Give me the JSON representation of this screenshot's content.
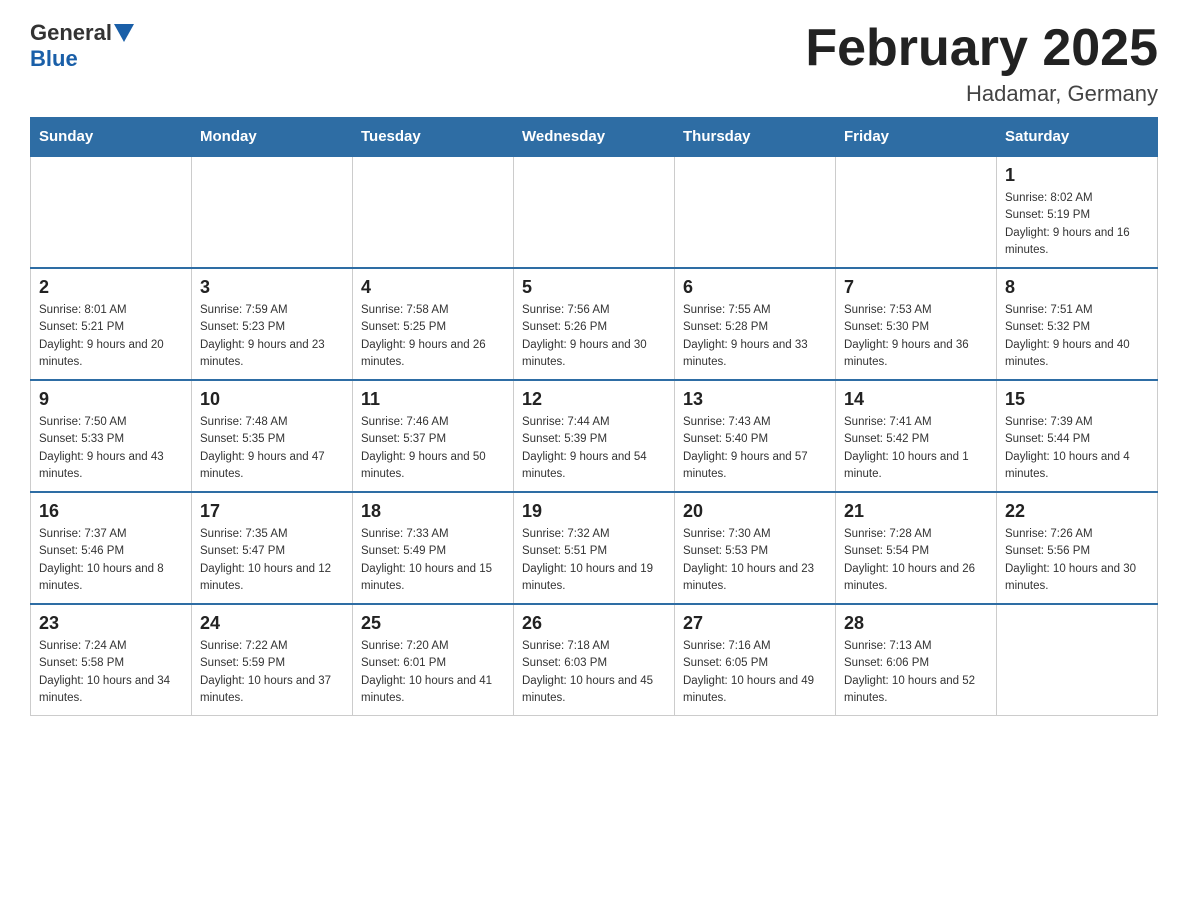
{
  "header": {
    "logo": {
      "general": "General",
      "blue": "Blue"
    },
    "title": "February 2025",
    "location": "Hadamar, Germany"
  },
  "weekdays": [
    "Sunday",
    "Monday",
    "Tuesday",
    "Wednesday",
    "Thursday",
    "Friday",
    "Saturday"
  ],
  "weeks": [
    [
      {
        "day": "",
        "info": ""
      },
      {
        "day": "",
        "info": ""
      },
      {
        "day": "",
        "info": ""
      },
      {
        "day": "",
        "info": ""
      },
      {
        "day": "",
        "info": ""
      },
      {
        "day": "",
        "info": ""
      },
      {
        "day": "1",
        "info": "Sunrise: 8:02 AM\nSunset: 5:19 PM\nDaylight: 9 hours and 16 minutes."
      }
    ],
    [
      {
        "day": "2",
        "info": "Sunrise: 8:01 AM\nSunset: 5:21 PM\nDaylight: 9 hours and 20 minutes."
      },
      {
        "day": "3",
        "info": "Sunrise: 7:59 AM\nSunset: 5:23 PM\nDaylight: 9 hours and 23 minutes."
      },
      {
        "day": "4",
        "info": "Sunrise: 7:58 AM\nSunset: 5:25 PM\nDaylight: 9 hours and 26 minutes."
      },
      {
        "day": "5",
        "info": "Sunrise: 7:56 AM\nSunset: 5:26 PM\nDaylight: 9 hours and 30 minutes."
      },
      {
        "day": "6",
        "info": "Sunrise: 7:55 AM\nSunset: 5:28 PM\nDaylight: 9 hours and 33 minutes."
      },
      {
        "day": "7",
        "info": "Sunrise: 7:53 AM\nSunset: 5:30 PM\nDaylight: 9 hours and 36 minutes."
      },
      {
        "day": "8",
        "info": "Sunrise: 7:51 AM\nSunset: 5:32 PM\nDaylight: 9 hours and 40 minutes."
      }
    ],
    [
      {
        "day": "9",
        "info": "Sunrise: 7:50 AM\nSunset: 5:33 PM\nDaylight: 9 hours and 43 minutes."
      },
      {
        "day": "10",
        "info": "Sunrise: 7:48 AM\nSunset: 5:35 PM\nDaylight: 9 hours and 47 minutes."
      },
      {
        "day": "11",
        "info": "Sunrise: 7:46 AM\nSunset: 5:37 PM\nDaylight: 9 hours and 50 minutes."
      },
      {
        "day": "12",
        "info": "Sunrise: 7:44 AM\nSunset: 5:39 PM\nDaylight: 9 hours and 54 minutes."
      },
      {
        "day": "13",
        "info": "Sunrise: 7:43 AM\nSunset: 5:40 PM\nDaylight: 9 hours and 57 minutes."
      },
      {
        "day": "14",
        "info": "Sunrise: 7:41 AM\nSunset: 5:42 PM\nDaylight: 10 hours and 1 minute."
      },
      {
        "day": "15",
        "info": "Sunrise: 7:39 AM\nSunset: 5:44 PM\nDaylight: 10 hours and 4 minutes."
      }
    ],
    [
      {
        "day": "16",
        "info": "Sunrise: 7:37 AM\nSunset: 5:46 PM\nDaylight: 10 hours and 8 minutes."
      },
      {
        "day": "17",
        "info": "Sunrise: 7:35 AM\nSunset: 5:47 PM\nDaylight: 10 hours and 12 minutes."
      },
      {
        "day": "18",
        "info": "Sunrise: 7:33 AM\nSunset: 5:49 PM\nDaylight: 10 hours and 15 minutes."
      },
      {
        "day": "19",
        "info": "Sunrise: 7:32 AM\nSunset: 5:51 PM\nDaylight: 10 hours and 19 minutes."
      },
      {
        "day": "20",
        "info": "Sunrise: 7:30 AM\nSunset: 5:53 PM\nDaylight: 10 hours and 23 minutes."
      },
      {
        "day": "21",
        "info": "Sunrise: 7:28 AM\nSunset: 5:54 PM\nDaylight: 10 hours and 26 minutes."
      },
      {
        "day": "22",
        "info": "Sunrise: 7:26 AM\nSunset: 5:56 PM\nDaylight: 10 hours and 30 minutes."
      }
    ],
    [
      {
        "day": "23",
        "info": "Sunrise: 7:24 AM\nSunset: 5:58 PM\nDaylight: 10 hours and 34 minutes."
      },
      {
        "day": "24",
        "info": "Sunrise: 7:22 AM\nSunset: 5:59 PM\nDaylight: 10 hours and 37 minutes."
      },
      {
        "day": "25",
        "info": "Sunrise: 7:20 AM\nSunset: 6:01 PM\nDaylight: 10 hours and 41 minutes."
      },
      {
        "day": "26",
        "info": "Sunrise: 7:18 AM\nSunset: 6:03 PM\nDaylight: 10 hours and 45 minutes."
      },
      {
        "day": "27",
        "info": "Sunrise: 7:16 AM\nSunset: 6:05 PM\nDaylight: 10 hours and 49 minutes."
      },
      {
        "day": "28",
        "info": "Sunrise: 7:13 AM\nSunset: 6:06 PM\nDaylight: 10 hours and 52 minutes."
      },
      {
        "day": "",
        "info": ""
      }
    ]
  ]
}
